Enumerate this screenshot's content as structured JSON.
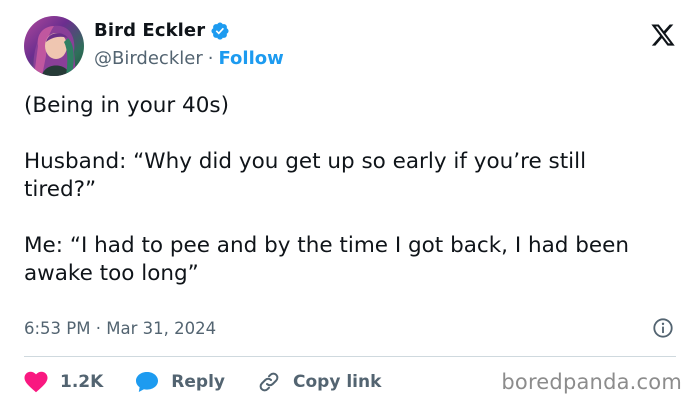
{
  "author": {
    "display_name": "Bird Eckler",
    "handle": "@Birdeckler",
    "separator": "·",
    "follow_label": "Follow",
    "verified": true
  },
  "tweet": {
    "lines": [
      "(Being in your 40s)",
      "Husband: “Why did you get up so early if you’re still tired?”",
      "Me: “I had to pee and by the time I got back, I had been awake too long”"
    ],
    "timestamp": "6:53 PM · Mar 31, 2024"
  },
  "actions": {
    "like_count": "1.2K",
    "reply_label": "Reply",
    "copy_link_label": "Copy link"
  },
  "watermark": "boredpanda.com",
  "icons": {
    "verified": "verified-badge-icon",
    "x_logo": "x-logo-icon",
    "info": "info-icon",
    "heart": "heart-icon",
    "reply": "reply-bubble-icon",
    "link": "link-icon"
  },
  "colors": {
    "accent": "#1d9bf0",
    "like": "#f91880",
    "text": "#0f1419",
    "muted": "#536471"
  }
}
